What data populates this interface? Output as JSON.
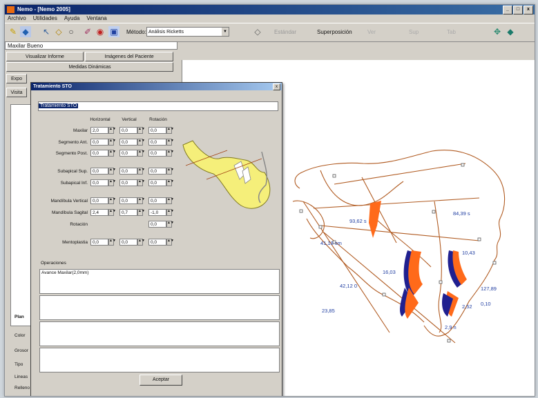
{
  "window": {
    "title": "Nemo - [Nemo 2005]",
    "minimize": "_",
    "maximize": "□",
    "close": "x"
  },
  "menu": [
    "Archivo",
    "Utilidades",
    "Ayuda",
    "Ventana"
  ],
  "toolbar": {
    "metodo_label": "Método:",
    "metodo_value": "Análisis Ricketts",
    "extra_combo": "Estándar",
    "superpos_label": "Superposición",
    "grey_items": [
      "Ver",
      "Sup",
      "Tab"
    ]
  },
  "patient": {
    "name": "Maxilar Bueno"
  },
  "left_panel": {
    "btn_informe": "Visualizar Informe",
    "btn_imagenes": "Imágenes del Paciente",
    "btn_medidas": "Medidas Dinámicas",
    "tab_label": "Expo",
    "vis_label": "Visita",
    "side_labels": [
      "Plan",
      "Color",
      "Grosor",
      "Tipo",
      "Lineas",
      "Relleno"
    ]
  },
  "dialog": {
    "title": "Tratamiento STO",
    "selected_item": "Tratamiento STO",
    "columns": [
      "Horizontal",
      "Vertical",
      "Rotación"
    ],
    "rows": [
      {
        "label": "Maxilar",
        "h": "2,0",
        "v": "0,0",
        "r": "0,0"
      },
      {
        "label": "Segmento Ant.",
        "h": "0,0",
        "v": "0,0",
        "r": "0,0"
      },
      {
        "label": "Segmento Post.",
        "h": "0,0",
        "v": "0,0",
        "r": "0,0"
      },
      {
        "label": "Subapical Sup.",
        "h": "0,0",
        "v": "0,0",
        "r": "0,0"
      },
      {
        "label": "Subapical Inf.",
        "h": "0,0",
        "v": "0,0",
        "r": "0,0"
      },
      {
        "label": "Mandíbula Vertical",
        "h": "0,0",
        "v": "0,0",
        "r": "0,0"
      },
      {
        "label": "Mandíbula Sagital",
        "h": "2,4",
        "v": "0,7",
        "r": "-1,0"
      }
    ],
    "rotacion_label": "Rotación",
    "rotacion_value": "0,0",
    "mentoplastia_label": "Mentoplastia",
    "mentoplastia": {
      "h": "0,0",
      "v": "0,0",
      "r": "0,0"
    },
    "observaciones_label": "Operaciones",
    "observaciones_text": "Avance Maxilar(2,0mm)",
    "accept": "Aceptar"
  },
  "canvas_labels": [
    {
      "text": "84,39 s"
    },
    {
      "text": "93,62 s"
    },
    {
      "text": "41,18 sm"
    },
    {
      "text": "16,03"
    },
    {
      "text": "42,12 0"
    },
    {
      "text": "10,43"
    },
    {
      "text": "127,89"
    },
    {
      "text": "2,52"
    },
    {
      "text": "0,10"
    },
    {
      "text": "23,85"
    },
    {
      "text": "2,9 n"
    }
  ],
  "colors": {
    "trace": "#b05a20",
    "orange": "#ff6a1a",
    "navy": "#202090",
    "measure": "#1e3ca0",
    "yellow": "#f5ef7a"
  }
}
